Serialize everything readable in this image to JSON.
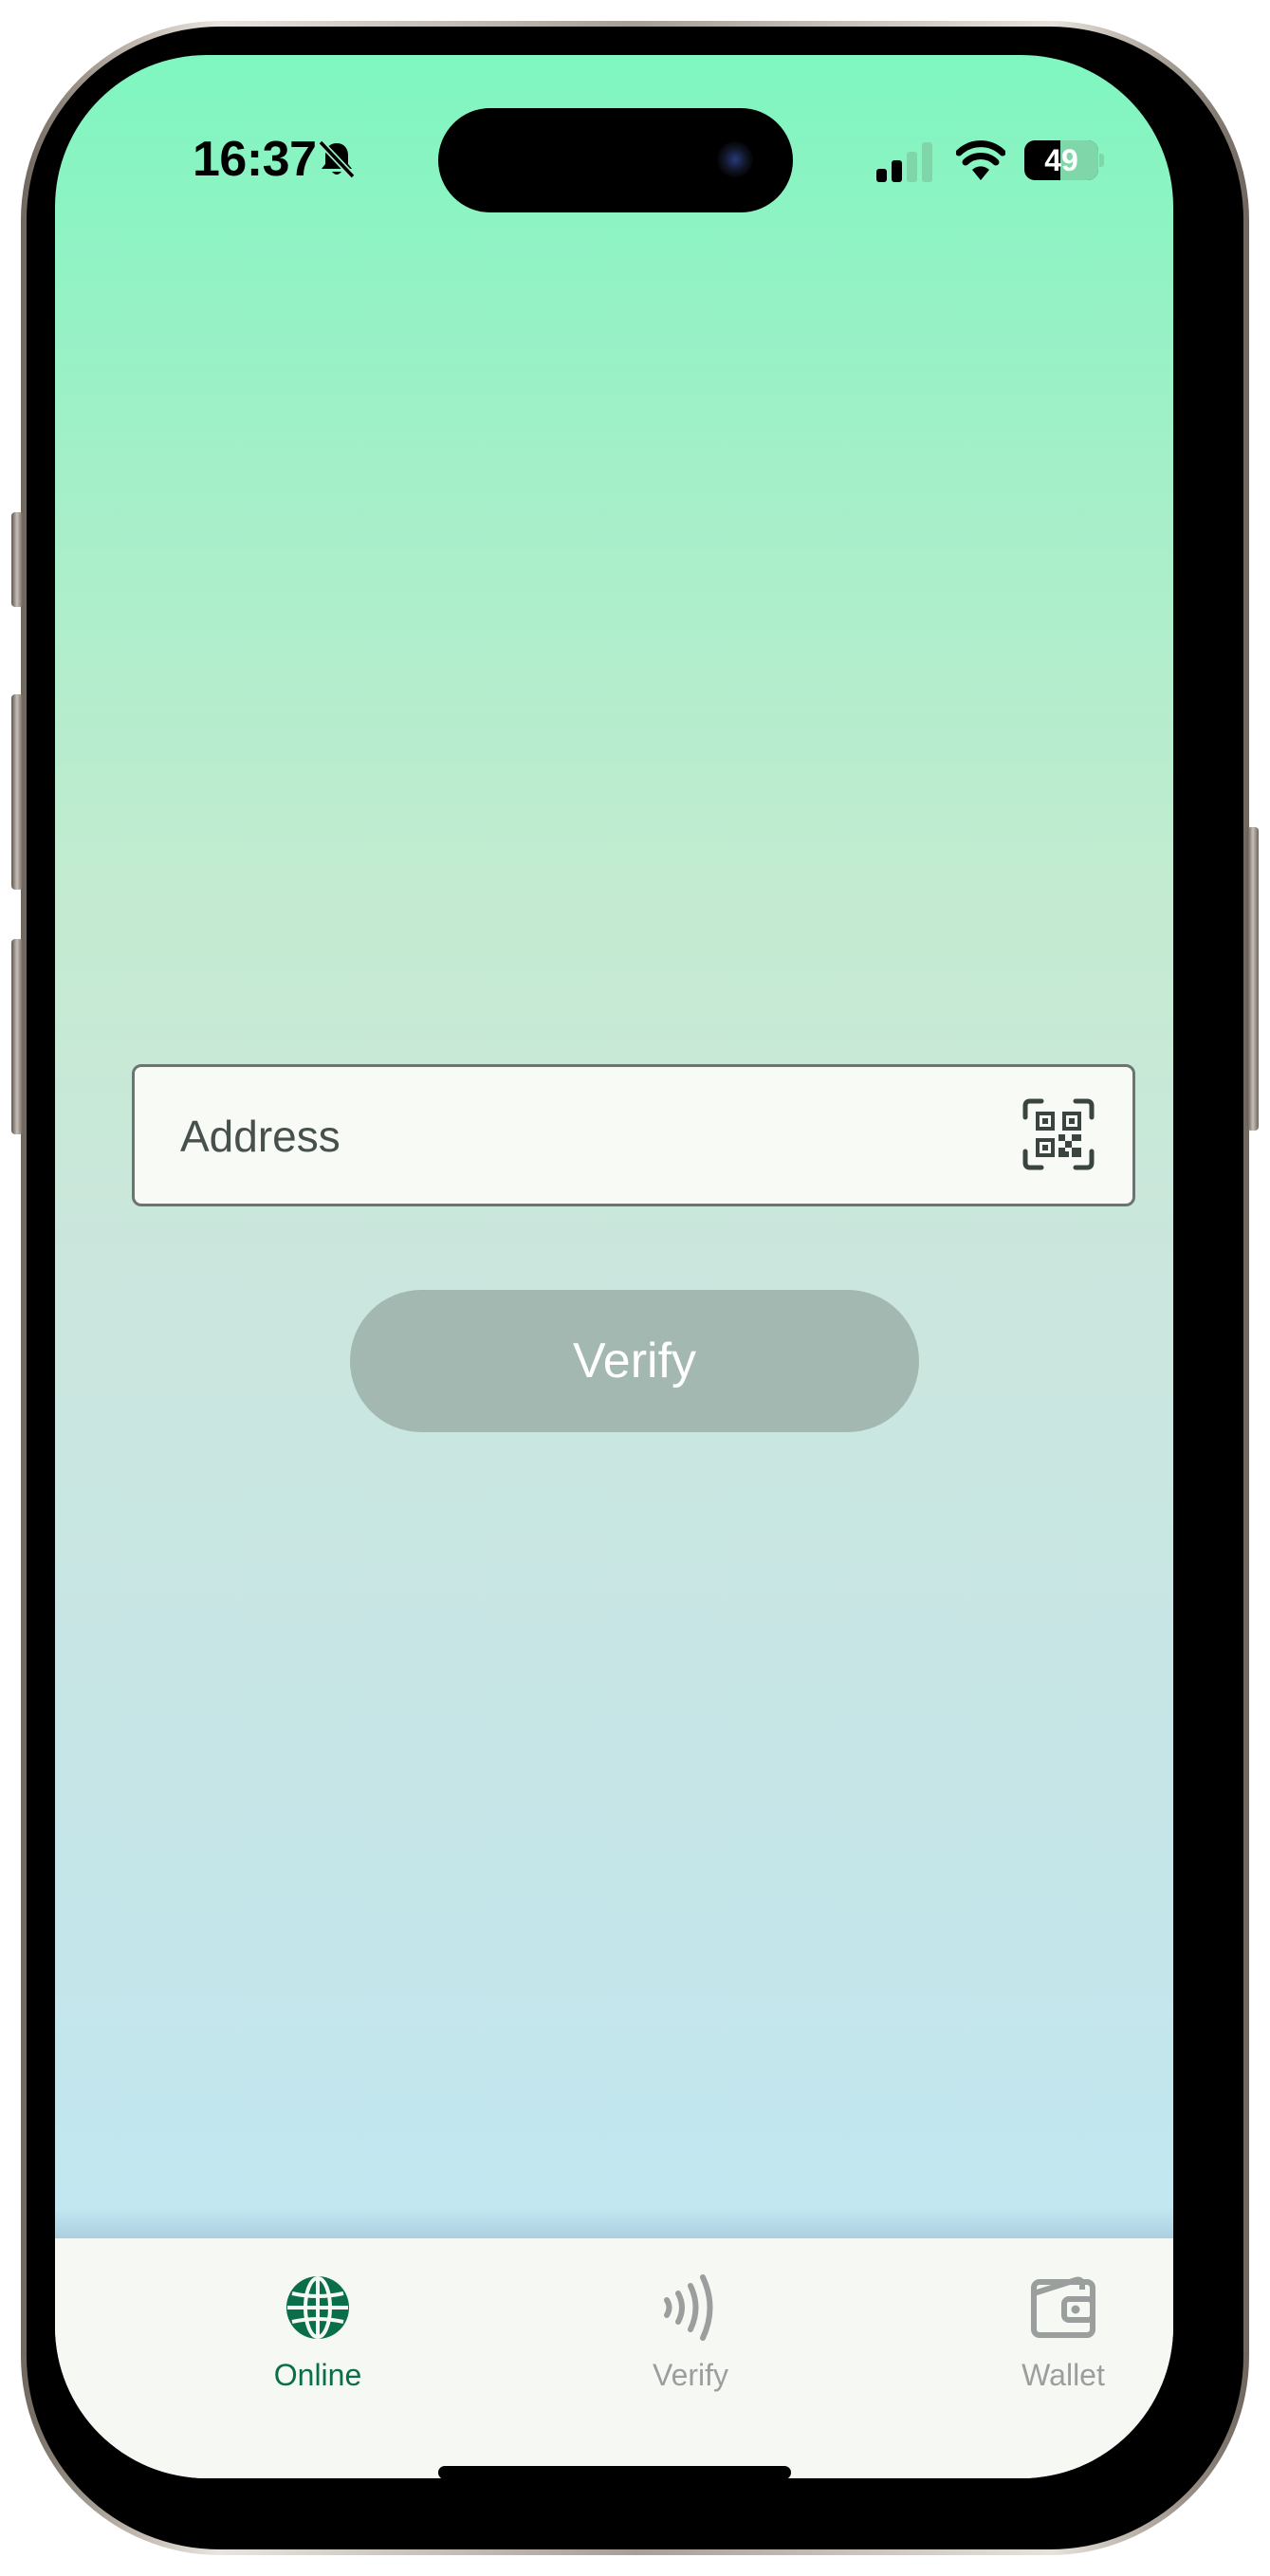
{
  "status_bar": {
    "time": "16:37",
    "battery_level": "49",
    "battery_fraction": 0.49,
    "icons": [
      "bell-slash-icon",
      "cellular-signal-icon",
      "wifi-icon",
      "battery-icon"
    ]
  },
  "main": {
    "address_field": {
      "value": "",
      "placeholder": "Address",
      "scan_icon": "qr-code-scan-icon"
    },
    "verify_button": {
      "label": "Verify",
      "enabled": false
    }
  },
  "tab_bar": {
    "tabs": [
      {
        "label": "Online",
        "icon": "globe-icon",
        "active": true
      },
      {
        "label": "Verify",
        "icon": "nfc-contactless-icon",
        "active": false
      },
      {
        "label": "Wallet",
        "icon": "wallet-icon",
        "active": false
      }
    ]
  },
  "colors": {
    "accent": "#0b6e4a",
    "inactive_tab": "#9a9e9c",
    "button_disabled_bg": "#a2b8b0",
    "gradient_top": "#7ff6c0",
    "gradient_bottom": "#bfe8f6",
    "tab_bar_bg": "#f6f8f4"
  }
}
